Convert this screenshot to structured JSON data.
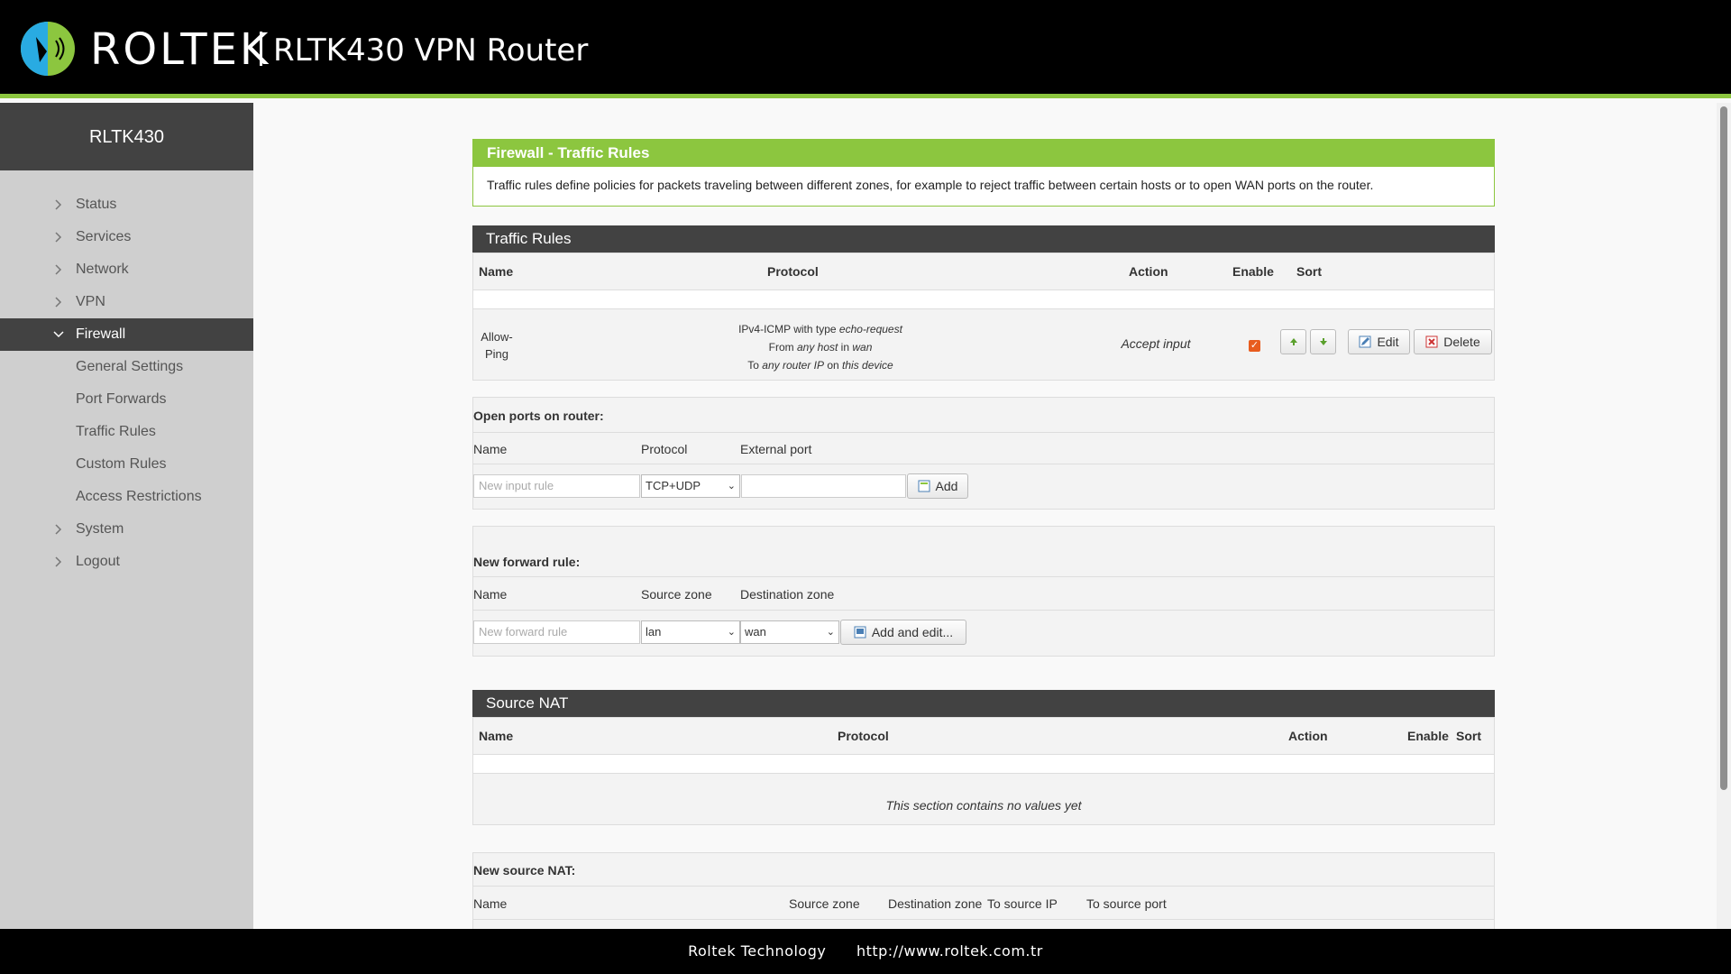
{
  "header": {
    "brand": "ROLTEK",
    "product": "RLTK430 VPN Router"
  },
  "sidebar": {
    "title": "RLTK430",
    "items": [
      {
        "label": "Status"
      },
      {
        "label": "Services"
      },
      {
        "label": "Network"
      },
      {
        "label": "VPN"
      },
      {
        "label": "Firewall"
      }
    ],
    "firewall_sub": [
      {
        "label": "General Settings"
      },
      {
        "label": "Port Forwards"
      },
      {
        "label": "Traffic Rules"
      },
      {
        "label": "Custom Rules"
      },
      {
        "label": "Access Restrictions"
      }
    ],
    "after": [
      {
        "label": "System"
      },
      {
        "label": "Logout"
      }
    ]
  },
  "page": {
    "title": "Firewall - Traffic Rules",
    "description": "Traffic rules define policies for packets traveling between different zones, for example to reject traffic between certain hosts or to open WAN ports on the router."
  },
  "traffic_rules": {
    "title": "Traffic Rules",
    "headers": {
      "name": "Name",
      "protocol": "Protocol",
      "action": "Action",
      "enable": "Enable",
      "sort": "Sort"
    },
    "row": {
      "name_line1": "Allow-",
      "name_line2": "Ping",
      "proto1_a": "IPv4-ICMP with type ",
      "proto1_b": "echo-request",
      "proto2_a": "From ",
      "proto2_b": "any host",
      "proto2_c": " in ",
      "proto2_d": "wan",
      "proto3_a": "To ",
      "proto3_b": "any router IP",
      "proto3_c": " on ",
      "proto3_d": "this device",
      "action": "Accept input",
      "enabled": true,
      "edit": "Edit",
      "delete": "Delete"
    }
  },
  "open_ports": {
    "title": "Open ports on router:",
    "col_name": "Name",
    "col_protocol": "Protocol",
    "col_port": "External port",
    "name_placeholder": "New input rule",
    "protocol_value": "TCP+UDP",
    "add": "Add"
  },
  "forward_rule": {
    "title": "New forward rule:",
    "col_name": "Name",
    "col_source": "Source zone",
    "col_dest": "Destination zone",
    "name_placeholder": "New forward rule",
    "source_value": "lan",
    "dest_value": "wan",
    "add": "Add and edit..."
  },
  "source_nat": {
    "title": "Source NAT",
    "headers": {
      "name": "Name",
      "protocol": "Protocol",
      "action": "Action",
      "enable": "Enable",
      "sort": "Sort"
    },
    "empty": "This section contains no values yet"
  },
  "new_snat": {
    "title": "New source NAT:",
    "col_name": "Name",
    "col_source": "Source zone",
    "col_dest": "Destination zone",
    "col_ip": "To source IP",
    "col_port": "To source port"
  },
  "footer": {
    "company": "Roltek Technology",
    "url": "http://www.roltek.com.tr"
  },
  "colors": {
    "accent": "#8cc63f",
    "dark": "#424242",
    "check": "#e85c1e"
  }
}
